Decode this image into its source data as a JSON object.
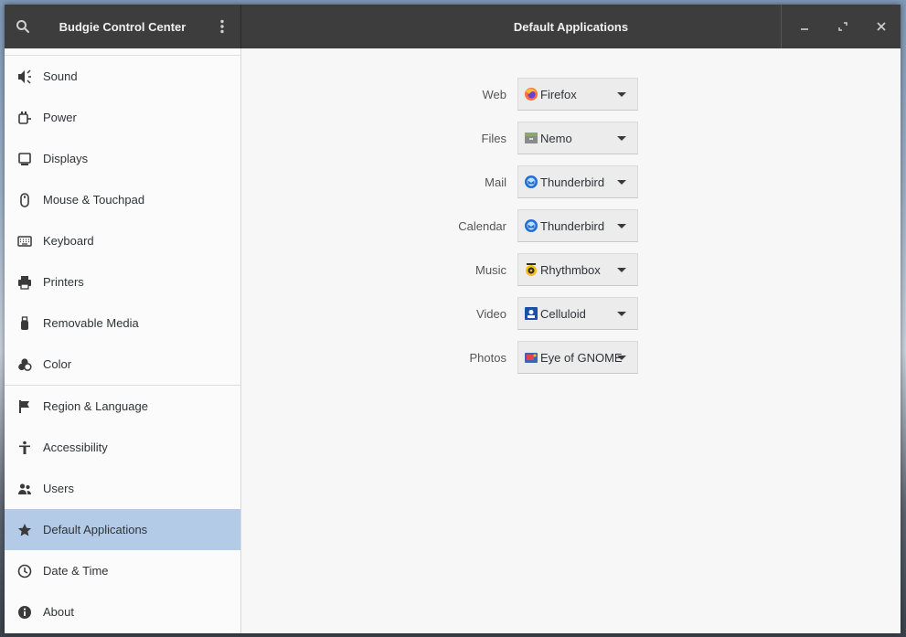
{
  "window": {
    "sidebar_title": "Budgie Control Center",
    "main_title": "Default Applications"
  },
  "sidebar": {
    "group1": [
      {
        "label": "Sound",
        "icon": "speaker-icon"
      },
      {
        "label": "Power",
        "icon": "power-plug-icon"
      },
      {
        "label": "Displays",
        "icon": "display-icon"
      },
      {
        "label": "Mouse & Touchpad",
        "icon": "mouse-icon"
      },
      {
        "label": "Keyboard",
        "icon": "keyboard-icon"
      },
      {
        "label": "Printers",
        "icon": "printer-icon"
      },
      {
        "label": "Removable Media",
        "icon": "usb-drive-icon"
      },
      {
        "label": "Color",
        "icon": "color-icon"
      }
    ],
    "group2": [
      {
        "label": "Region & Language",
        "icon": "flag-icon"
      },
      {
        "label": "Accessibility",
        "icon": "accessibility-icon"
      },
      {
        "label": "Users",
        "icon": "users-icon"
      },
      {
        "label": "Default Applications",
        "icon": "star-icon",
        "selected": true
      },
      {
        "label": "Date & Time",
        "icon": "clock-icon"
      },
      {
        "label": "About",
        "icon": "info-icon"
      }
    ]
  },
  "defaults": [
    {
      "label": "Web",
      "app": "Firefox",
      "icon": "firefox-icon"
    },
    {
      "label": "Files",
      "app": "Nemo",
      "icon": "nemo-icon"
    },
    {
      "label": "Mail",
      "app": "Thunderbird",
      "icon": "thunderbird-icon"
    },
    {
      "label": "Calendar",
      "app": "Thunderbird",
      "icon": "thunderbird-icon"
    },
    {
      "label": "Music",
      "app": "Rhythmbox",
      "icon": "rhythmbox-icon"
    },
    {
      "label": "Video",
      "app": "Celluloid",
      "icon": "celluloid-icon"
    },
    {
      "label": "Photos",
      "app": "Eye of GNOME",
      "icon": "eye-of-gnome-icon"
    }
  ],
  "colors": {
    "headerbar": "#3d3d3d",
    "selection": "#b4cbe8",
    "content_bg": "#f7f7f7"
  }
}
